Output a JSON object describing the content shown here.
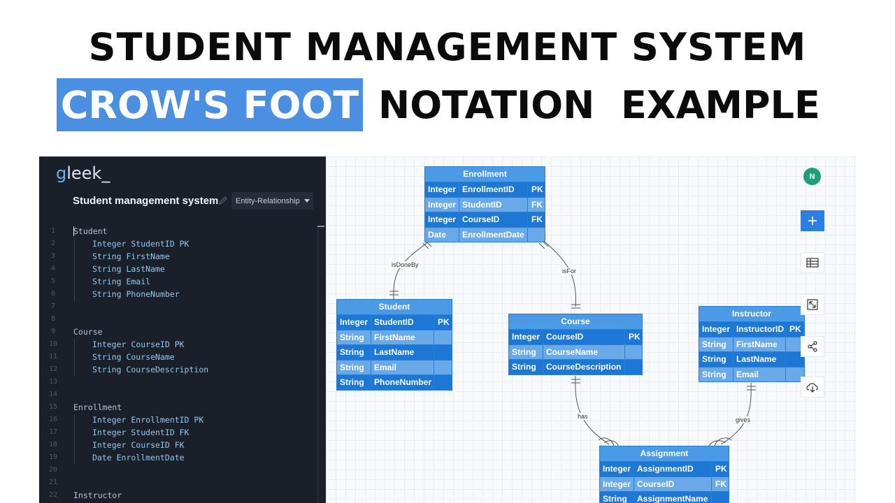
{
  "heading": {
    "line1": "STUDENT MANAGEMENT SYSTEM",
    "highlight": "CROW'S FOOT",
    "rest": "NOTATION  EXAMPLE"
  },
  "editor": {
    "logo_g": "g",
    "logo_rest": "leek_",
    "doc_title": "Student management system",
    "diagram_type": "Entity-Relationship",
    "lines": [
      {
        "n": "1",
        "text": "Student"
      },
      {
        "n": "2",
        "text": "Integer StudentID PK",
        "indent": true
      },
      {
        "n": "3",
        "text": "String FirstName",
        "indent": true
      },
      {
        "n": "4",
        "text": "String LastName",
        "indent": true
      },
      {
        "n": "5",
        "text": "String Email",
        "indent": true
      },
      {
        "n": "6",
        "text": "String PhoneNumber",
        "indent": true
      },
      {
        "n": "7",
        "text": ""
      },
      {
        "n": "8",
        "text": ""
      },
      {
        "n": "9",
        "text": "Course"
      },
      {
        "n": "10",
        "text": "Integer CourseID PK",
        "indent": true
      },
      {
        "n": "11",
        "text": "String CourseName",
        "indent": true
      },
      {
        "n": "12",
        "text": "String CourseDescription",
        "indent": true
      },
      {
        "n": "13",
        "text": ""
      },
      {
        "n": "14",
        "text": ""
      },
      {
        "n": "15",
        "text": "Enrollment"
      },
      {
        "n": "16",
        "text": "Integer EnrollmentID PK",
        "indent": true
      },
      {
        "n": "17",
        "text": "Integer StudentID FK",
        "indent": true
      },
      {
        "n": "18",
        "text": "Integer CourseID FK",
        "indent": true
      },
      {
        "n": "19",
        "text": "Date EnrollmentDate",
        "indent": true
      },
      {
        "n": "20",
        "text": ""
      },
      {
        "n": "21",
        "text": ""
      },
      {
        "n": "22",
        "text": "Instructor"
      }
    ]
  },
  "canvas": {
    "avatar_initial": "N",
    "entities": {
      "enrollment": {
        "name": "Enrollment",
        "rows": [
          [
            "Integer",
            "EnrollmentID",
            "PK"
          ],
          [
            "Integer",
            "StudentID",
            "FK"
          ],
          [
            "Integer",
            "CourseID",
            "FK"
          ],
          [
            "Date",
            "EnrollmentDate",
            ""
          ]
        ]
      },
      "student": {
        "name": "Student",
        "rows": [
          [
            "Integer",
            "StudentID",
            "PK"
          ],
          [
            "String",
            "FirstName",
            ""
          ],
          [
            "String",
            "LastName",
            ""
          ],
          [
            "String",
            "Email",
            ""
          ],
          [
            "String",
            "PhoneNumber",
            ""
          ]
        ]
      },
      "course": {
        "name": "Course",
        "rows": [
          [
            "Integer",
            "CourseID",
            "PK"
          ],
          [
            "String",
            "CourseName",
            ""
          ],
          [
            "String",
            "CourseDescription",
            ""
          ]
        ]
      },
      "instructor": {
        "name": "Instructor",
        "rows": [
          [
            "Integer",
            "InstructorID",
            "PK"
          ],
          [
            "String",
            "FirstName",
            ""
          ],
          [
            "String",
            "LastName",
            ""
          ],
          [
            "String",
            "Email",
            ""
          ]
        ]
      },
      "assignment": {
        "name": "Assignment",
        "rows": [
          [
            "Integer",
            "AssignmentID",
            "PK"
          ],
          [
            "Integer",
            "CourseID",
            "FK"
          ],
          [
            "String",
            "AssignmentName",
            ""
          ]
        ]
      }
    },
    "relationships": {
      "isDoneBy": "isDoneBy",
      "isFor": "isFor",
      "has": "has",
      "gives": "gives"
    },
    "tools": [
      "plus-icon",
      "table-icon",
      "expand-icon",
      "share-icon",
      "cloud-download-icon"
    ]
  }
}
